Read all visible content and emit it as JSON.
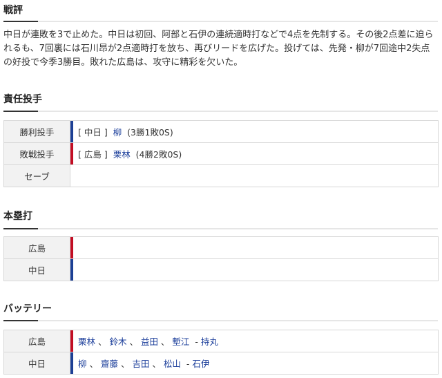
{
  "commentary": {
    "title": "戦評",
    "text": "中日が連敗を3で止めた。中日は初回、阿部と石伊の連続適時打などで4点を先制する。その後2点差に迫られるも、7回裏には石川昂が2点適時打を放ち、再びリードを広げた。投げては、先発・柳が7回途中2失点の好投で今季3勝目。敗れた広島は、攻守に精彩を欠いた。"
  },
  "pitchers": {
    "title": "責任投手",
    "win": {
      "label": "勝利投手",
      "team": "中日",
      "name": "柳",
      "record": "(3勝1敗0S)"
    },
    "loss": {
      "label": "敗戦投手",
      "team": "広島",
      "name": "栗林",
      "record": "(4勝2敗0S)"
    },
    "save": {
      "label": "セーブ"
    }
  },
  "homeruns": {
    "title": "本塁打",
    "rows": [
      {
        "team": "広島"
      },
      {
        "team": "中日"
      }
    ]
  },
  "battery": {
    "title": "バッテリー",
    "hiroshima": {
      "team": "広島",
      "p1": "栗林",
      "p2": "鈴木",
      "p3": "益田",
      "p4": "塹江",
      "catcher": "持丸"
    },
    "chunichi": {
      "team": "中日",
      "p1": "柳",
      "p2": "齋藤",
      "p3": "吉田",
      "p4": "松山",
      "catcher": "石伊"
    }
  },
  "colors": {
    "chunichi": "#1c3f94",
    "hiroshima": "#c20d23",
    "link": "#1a3d9a"
  }
}
